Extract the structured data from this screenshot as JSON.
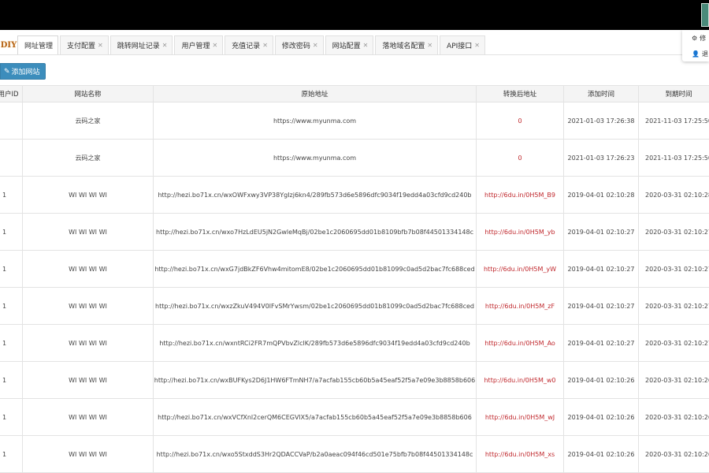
{
  "tabs": [
    {
      "label": "网址管理",
      "active": true
    },
    {
      "label": "支付配置",
      "active": false
    },
    {
      "label": "跳转网址记录",
      "active": false
    },
    {
      "label": "用户管理",
      "active": false
    },
    {
      "label": "充值记录",
      "active": false
    },
    {
      "label": "修改密码",
      "active": false
    },
    {
      "label": "网站配置",
      "active": false
    },
    {
      "label": "落地域名配置",
      "active": false
    },
    {
      "label": "API接口",
      "active": false
    }
  ],
  "logo_text": "DIY",
  "user_menu": {
    "items": [
      {
        "icon": "⚙",
        "label": "修"
      },
      {
        "icon": "👤",
        "label": "退"
      }
    ]
  },
  "toolbar": {
    "add_label": "添加网站",
    "add_icon": "✎"
  },
  "table": {
    "columns": [
      "用户ID",
      "网站名称",
      "原始地址",
      "转换后地址",
      "添加时间",
      "到期时间"
    ],
    "rows": [
      {
        "uid": "",
        "name": "云码之家",
        "url": "https://www.myunma.com",
        "converted": "0",
        "added": "2021-01-03 17:26:38",
        "expires": "2021-11-03 17:25:50"
      },
      {
        "uid": "",
        "name": "云码之家",
        "url": "https://www.myunma.com",
        "converted": "0",
        "added": "2021-01-03 17:26:23",
        "expires": "2021-11-03 17:25:50"
      },
      {
        "uid": "1",
        "name": "WI WI WI WI",
        "url": "http://hezi.bo71x.cn/wxOWFxwy3VP38YgIzj6kn4/289fb573d6e5896dfc9034f19edd4a03cfd9cd240b",
        "converted": "http://6du.in/0H5M_B9",
        "added": "2019-04-01 02:10:28",
        "expires": "2020-03-31 02:10:28"
      },
      {
        "uid": "1",
        "name": "WI WI WI WI",
        "url": "http://hezi.bo71x.cn/wxo7HzLdEU5jN2GwleMqBj/02be1c2060695dd01b8109bfb7b08f44501334148c",
        "converted": "http://6du.in/0H5M_yb",
        "added": "2019-04-01 02:10:27",
        "expires": "2020-03-31 02:10:27"
      },
      {
        "uid": "1",
        "name": "WI WI WI WI",
        "url": "http://hezi.bo71x.cn/wxG7jdBkZF6Vhw4mitomE8/02be1c2060695dd01b81099c0ad5d2bac7fc688ced",
        "converted": "http://6du.in/0H5M_yW",
        "added": "2019-04-01 02:10:27",
        "expires": "2020-03-31 02:10:27"
      },
      {
        "uid": "1",
        "name": "WI WI WI WI",
        "url": "http://hezi.bo71x.cn/wxzZkuV494V0lFvSMrYwsm/02be1c2060695dd01b81099c0ad5d2bac7fc688ced",
        "converted": "http://6du.in/0H5M_zF",
        "added": "2019-04-01 02:10:27",
        "expires": "2020-03-31 02:10:27"
      },
      {
        "uid": "1",
        "name": "WI WI WI WI",
        "url": "http://hezi.bo71x.cn/wxntRCi2FR7mQPVbvZlclK/289fb573d6e5896dfc9034f19edd4a03cfd9cd240b",
        "converted": "http://6du.in/0H5M_Ao",
        "added": "2019-04-01 02:10:27",
        "expires": "2020-03-31 02:10:27"
      },
      {
        "uid": "1",
        "name": "WI WI WI WI",
        "url": "http://hezi.bo71x.cn/wxBUFKys2D6J1HW6FTmNH7/a7acfab155cb60b5a45eaf52f5a7e09e3b8858b606",
        "converted": "http://6du.in/0H5M_w0",
        "added": "2019-04-01 02:10:26",
        "expires": "2020-03-31 02:10:26"
      },
      {
        "uid": "1",
        "name": "WI WI WI WI",
        "url": "http://hezi.bo71x.cn/wxVCfXnl2cerQM6CEGVlX5/a7acfab155cb60b5a45eaf52f5a7e09e3b8858b606",
        "converted": "http://6du.in/0H5M_wJ",
        "added": "2019-04-01 02:10:26",
        "expires": "2020-03-31 02:10:26"
      },
      {
        "uid": "1",
        "name": "WI WI WI WI",
        "url": "http://hezi.bo71x.cn/wxo5StxddS3Hr2QDACCVaP/b2a0aeac094f46cd501e75bfb7b08f44501334148c",
        "converted": "http://6du.in/0H5M_xs",
        "added": "2019-04-01 02:10:26",
        "expires": "2020-03-31 02:10:26"
      }
    ]
  }
}
